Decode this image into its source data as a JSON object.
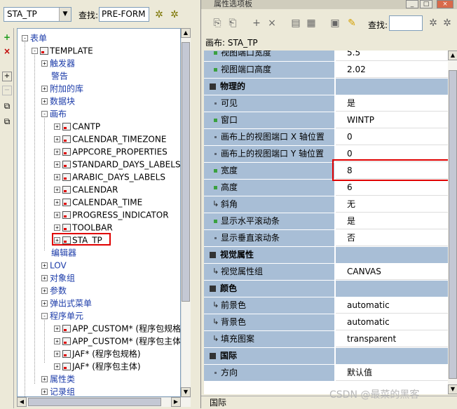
{
  "navigator": {
    "object_combo": "STA_TP",
    "find_label": "查找:",
    "find_value": "PRE-FORM",
    "tree": [
      {
        "label": "表单",
        "level": 0,
        "exp": "-",
        "blue": true,
        "icon": false
      },
      {
        "label": "TEMPLATE",
        "level": 1,
        "exp": "-",
        "blue": false,
        "icon": true
      },
      {
        "label": "触发器",
        "level": 2,
        "exp": "+",
        "blue": true,
        "icon": false
      },
      {
        "label": "警告",
        "level": 2,
        "exp": "",
        "blue": true,
        "icon": false
      },
      {
        "label": "附加的库",
        "level": 2,
        "exp": "+",
        "blue": true,
        "icon": false
      },
      {
        "label": "数据块",
        "level": 2,
        "exp": "+",
        "blue": true,
        "icon": false
      },
      {
        "label": "画布",
        "level": 2,
        "exp": "-",
        "blue": true,
        "icon": false
      },
      {
        "label": "CANTP",
        "level": 3,
        "exp": "+",
        "blue": false,
        "icon": true
      },
      {
        "label": "CALENDAR_TIMEZONE",
        "level": 3,
        "exp": "+",
        "blue": false,
        "icon": true
      },
      {
        "label": "APPCORE_PROPERTIES",
        "level": 3,
        "exp": "+",
        "blue": false,
        "icon": true
      },
      {
        "label": "STANDARD_DAYS_LABELS",
        "level": 3,
        "exp": "+",
        "blue": false,
        "icon": true
      },
      {
        "label": "ARABIC_DAYS_LABELS",
        "level": 3,
        "exp": "+",
        "blue": false,
        "icon": true
      },
      {
        "label": "CALENDAR",
        "level": 3,
        "exp": "+",
        "blue": false,
        "icon": true
      },
      {
        "label": "CALENDAR_TIME",
        "level": 3,
        "exp": "+",
        "blue": false,
        "icon": true
      },
      {
        "label": "PROGRESS_INDICATOR",
        "level": 3,
        "exp": "+",
        "blue": false,
        "icon": true
      },
      {
        "label": "TOOLBAR",
        "level": 3,
        "exp": "+",
        "blue": false,
        "icon": true
      },
      {
        "label": "STA_TP",
        "level": 3,
        "exp": "+",
        "blue": false,
        "icon": true
      },
      {
        "label": "编辑器",
        "level": 2,
        "exp": "",
        "blue": true,
        "icon": false
      },
      {
        "label": "LOV",
        "level": 2,
        "exp": "+",
        "blue": true,
        "icon": false
      },
      {
        "label": "对象组",
        "level": 2,
        "exp": "+",
        "blue": true,
        "icon": false
      },
      {
        "label": "参数",
        "level": 2,
        "exp": "+",
        "blue": true,
        "icon": false
      },
      {
        "label": "弹出式菜单",
        "level": 2,
        "exp": "+",
        "blue": true,
        "icon": false
      },
      {
        "label": "程序单元",
        "level": 2,
        "exp": "-",
        "blue": true,
        "icon": false
      },
      {
        "label": "APP_CUSTOM* (程序包规格",
        "level": 3,
        "exp": "+",
        "blue": false,
        "icon": true
      },
      {
        "label": "APP_CUSTOM* (程序包主体",
        "level": 3,
        "exp": "+",
        "blue": false,
        "icon": true
      },
      {
        "label": "JAF* (程序包规格)",
        "level": 3,
        "exp": "+",
        "blue": false,
        "icon": true
      },
      {
        "label": "JAF* (程序包主体)",
        "level": 3,
        "exp": "+",
        "blue": false,
        "icon": true
      },
      {
        "label": "属性类",
        "level": 2,
        "exp": "+",
        "blue": true,
        "icon": false
      },
      {
        "label": "记录组",
        "level": 2,
        "exp": "+",
        "blue": true,
        "icon": false
      }
    ]
  },
  "palette": {
    "title": "属性选项板",
    "find_label": "查找:",
    "context": "画布: STA_TP",
    "rows": [
      {
        "type": "prop",
        "marker": "green",
        "name": "视图端口宽度",
        "value": "5.5"
      },
      {
        "type": "prop",
        "marker": "green",
        "name": "视图端口高度",
        "value": "2.02"
      },
      {
        "type": "section",
        "name": "物理的",
        "value": ""
      },
      {
        "type": "prop",
        "marker": "dot",
        "name": "可见",
        "value": "是"
      },
      {
        "type": "prop",
        "marker": "green",
        "name": "窗口",
        "value": "WINTP"
      },
      {
        "type": "prop",
        "marker": "dot",
        "name": "画布上的视图端口 X 轴位置",
        "value": "0"
      },
      {
        "type": "prop",
        "marker": "dot",
        "name": "画布上的视图端口 Y 轴位置",
        "value": "0"
      },
      {
        "type": "prop",
        "marker": "green",
        "name": "宽度",
        "value": "8"
      },
      {
        "type": "prop",
        "marker": "green",
        "name": "高度",
        "value": "6"
      },
      {
        "type": "prop",
        "marker": "arrow",
        "name": "斜角",
        "value": "无"
      },
      {
        "type": "prop",
        "marker": "green",
        "name": "显示水平滚动条",
        "value": "是"
      },
      {
        "type": "prop",
        "marker": "dot",
        "name": "显示垂直滚动条",
        "value": "否"
      },
      {
        "type": "section",
        "name": "视觉属性",
        "value": ""
      },
      {
        "type": "prop",
        "marker": "arrow",
        "name": "视觉属性组",
        "value": "CANVAS"
      },
      {
        "type": "section",
        "name": "颜色",
        "value": ""
      },
      {
        "type": "prop",
        "marker": "arrow",
        "name": "前景色",
        "value": "automatic"
      },
      {
        "type": "prop",
        "marker": "arrow",
        "name": "背景色",
        "value": "automatic"
      },
      {
        "type": "prop",
        "marker": "arrow",
        "name": "填充图案",
        "value": "transparent"
      },
      {
        "type": "section",
        "name": "国际",
        "value": ""
      },
      {
        "type": "prop",
        "marker": "dot",
        "name": "方向",
        "value": "默认值"
      }
    ],
    "status": "国际"
  },
  "watermark": "CSDN @最菜的黑客"
}
